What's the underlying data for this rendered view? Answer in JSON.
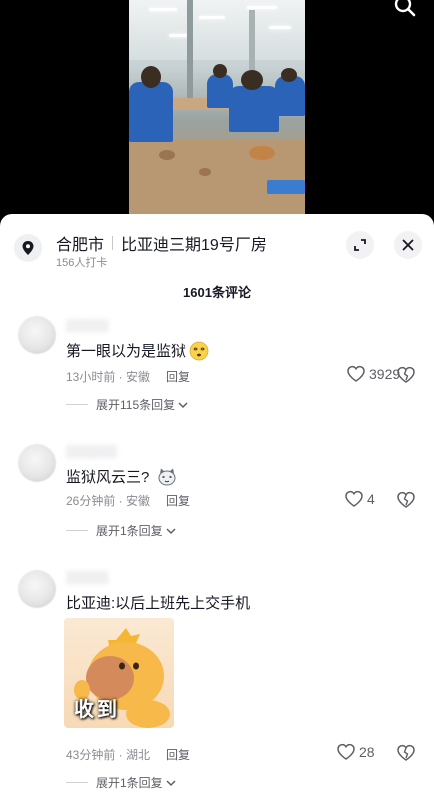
{
  "location": {
    "city": "合肥市",
    "place": "比亚迪三期19号厂房",
    "checkins": "156人打卡"
  },
  "comments_header": {
    "count_label": "1601条评论"
  },
  "comments": [
    {
      "text": "第一眼以为是监狱",
      "emoji_icon": "dizzy-face-emoji",
      "time_location": "13小时前 · 安徽",
      "reply_label": "回复",
      "likes": "3929",
      "expand_label": "展开115条回复"
    },
    {
      "text": "监狱风云三?",
      "emoji_icon": "cat-face-emoji",
      "time_location": "26分钟前 · 安徽",
      "reply_label": "回复",
      "likes": "4",
      "expand_label": "展开1条回复"
    },
    {
      "text": "比亚迪:以后上班先上交手机",
      "sticker_caption": "收到",
      "time_location": "43分钟前 · 湖北",
      "reply_label": "回复",
      "likes": "28",
      "expand_label": "展开1条回复"
    }
  ],
  "colors": {
    "sheet_bg": "#ffffff",
    "primary_text": "#161823",
    "secondary_text": "#8a8b91",
    "uniform_blue": "#2a63b8"
  }
}
